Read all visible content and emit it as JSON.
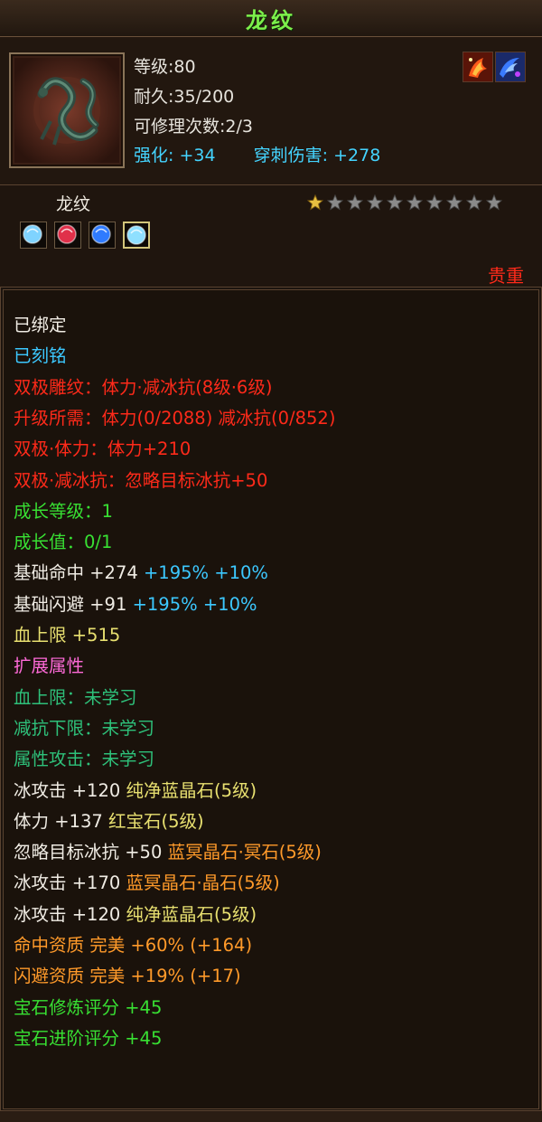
{
  "title": "龙纹",
  "header": {
    "icon_name": "dragon-emblem-icon",
    "level": "等级:80",
    "durability": "耐久:35/200",
    "repairs": "可修理次数:2/3",
    "enhance_label": "强化:",
    "enhance_value": "+34",
    "pierce_label": "穿刺伤害:",
    "pierce_value": "+278",
    "corner_icons": [
      "fire-flower-icon",
      "blue-swirl-icon"
    ]
  },
  "name_panel": {
    "item_name": "龙纹",
    "gems": [
      {
        "icon": "cyan-gem-icon",
        "color": "#7fd3ff"
      },
      {
        "icon": "red-gem-icon",
        "color": "#e0304a"
      },
      {
        "icon": "blue-gem-icon",
        "color": "#2f7bff"
      },
      {
        "icon": "cyan-gem-icon",
        "color": "#8fe0ff"
      }
    ],
    "star_rating": 1,
    "star_total": 10,
    "rarity": "贵重"
  },
  "colors": {
    "white": "#f0ece4",
    "cyan": "#3cc8ff",
    "red": "#ff2a1a",
    "green": "#38e033",
    "pink": "#ff6ad8",
    "teal": "#2ec07a",
    "orange": "#ff9a2a",
    "yellow": "#e8e070"
  },
  "attributes": [
    [
      {
        "t": "已绑定",
        "c": "white"
      }
    ],
    [
      {
        "t": "已刻铭",
        "c": "cyan"
      }
    ],
    [
      {
        "t": "双极雕纹：体力·减冰抗(8级·6级)",
        "c": "red"
      }
    ],
    [
      {
        "t": "升级所需：体力(0/2088) 减冰抗(0/852)",
        "c": "red"
      }
    ],
    [
      {
        "t": "双极·体力：体力+210",
        "c": "red"
      }
    ],
    [
      {
        "t": "双极·减冰抗：忽略目标冰抗+50",
        "c": "red"
      }
    ],
    [
      {
        "t": "成长等级：1",
        "c": "green"
      }
    ],
    [
      {
        "t": "成长值：0/1",
        "c": "green"
      }
    ],
    [
      {
        "t": "基础命中 +274 ",
        "c": "white"
      },
      {
        "t": "+195% +10%",
        "c": "cyan"
      }
    ],
    [
      {
        "t": "基础闪避 +91 ",
        "c": "white"
      },
      {
        "t": "+195% +10%",
        "c": "cyan"
      }
    ],
    [
      {
        "t": "血上限 +515",
        "c": "yellow"
      }
    ],
    [
      {
        "t": "扩展属性",
        "c": "pink"
      }
    ],
    [
      {
        "t": "血上限：未学习",
        "c": "teal"
      }
    ],
    [
      {
        "t": "减抗下限：未学习",
        "c": "teal"
      }
    ],
    [
      {
        "t": "属性攻击：未学习",
        "c": "teal"
      }
    ],
    [
      {
        "t": "冰攻击 +120 ",
        "c": "white"
      },
      {
        "t": "纯净蓝晶石(5级)",
        "c": "yellow"
      }
    ],
    [
      {
        "t": "体力 +137 ",
        "c": "white"
      },
      {
        "t": "红宝石(5级)",
        "c": "yellow"
      }
    ],
    [
      {
        "t": "忽略目标冰抗 +50 ",
        "c": "white"
      },
      {
        "t": "蓝冥晶石·冥石(5级)",
        "c": "orange"
      }
    ],
    [
      {
        "t": "冰攻击 +170 ",
        "c": "white"
      },
      {
        "t": "蓝冥晶石·晶石(5级)",
        "c": "orange"
      }
    ],
    [
      {
        "t": "冰攻击 +120 ",
        "c": "white"
      },
      {
        "t": "纯净蓝晶石(5级)",
        "c": "yellow"
      }
    ],
    [
      {
        "t": "命中资质 完美 +60% (+164)",
        "c": "orange"
      }
    ],
    [
      {
        "t": "闪避资质 完美 +19% (+17)",
        "c": "orange"
      }
    ],
    [
      {
        "t": "宝石修炼评分 +45",
        "c": "green"
      }
    ],
    [
      {
        "t": "宝石进阶评分 +45",
        "c": "green"
      }
    ]
  ]
}
